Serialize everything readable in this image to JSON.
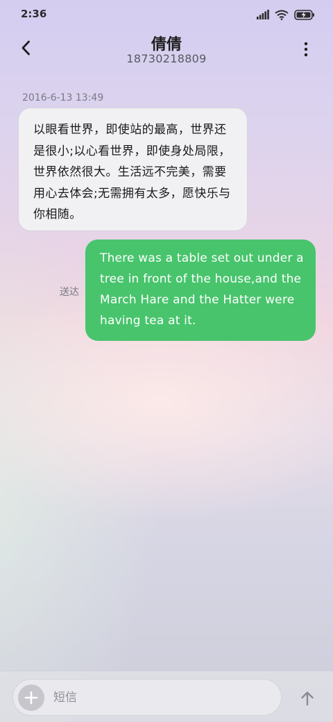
{
  "status_bar": {
    "time": "2:36",
    "icons": [
      "signal-icon",
      "wifi-icon",
      "battery-charging-icon"
    ]
  },
  "header": {
    "title": "倩倩",
    "subtitle": "18730218809",
    "back_icon": "back-arrow-icon",
    "more_icon": "more-vertical-icon"
  },
  "messages": [
    {
      "direction": "incoming",
      "timestamp": "2016-6-13 13:49",
      "text": "以眼看世界，即使站的最高，世界还是很小;以心看世界，即使身处局限，世界依然很大。生活远不完美，需要用心去体会;无需拥有太多，愿快乐与你相随。"
    },
    {
      "direction": "outgoing",
      "status": "送达",
      "text": "There was a table set out under a tree in front of the house,and the March Hare and the Hatter were having tea at it."
    }
  ],
  "composer": {
    "placeholder": "短信",
    "value": "",
    "add_icon": "plus-icon",
    "send_icon": "send-arrow-icon"
  },
  "colors": {
    "outgoing_bubble": "#48c46c",
    "incoming_bubble": "#f1f0f3"
  }
}
